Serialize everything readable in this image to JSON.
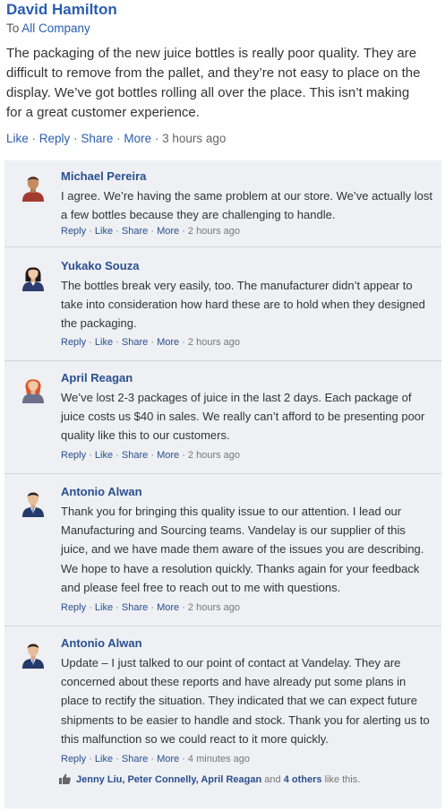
{
  "post": {
    "author": "David Hamilton",
    "to_prefix": "To",
    "to_group": "All Company",
    "body": "The packaging of the new juice bottles is really poor quality. They are difficult to remove from the pallet, and they’re not easy to place on the display. We’ve got bottles rolling all over the place. This isn’t making for a great customer experience.",
    "actions": {
      "like": "Like",
      "reply": "Reply",
      "share": "Share",
      "more": "More",
      "time": "3 hours ago"
    }
  },
  "comment_actions": {
    "reply": "Reply",
    "like": "Like",
    "share": "Share",
    "more": "More"
  },
  "comments": [
    {
      "name": "Michael Pereira",
      "body": "I agree. We’re having the same problem at our store. We’ve actually lost a few bottles because they are challenging to handle.",
      "time": "2 hours ago",
      "avatar": "man-avatar-icon"
    },
    {
      "name": "Yukako Souza",
      "body": "The bottles break very easily, too. The manufacturer didn’t appear to take into consideration how hard these are to hold when they designed the packaging.",
      "time": "2 hours ago",
      "avatar": "woman-avatar-icon"
    },
    {
      "name": "April Reagan",
      "body": "We’ve lost 2-3 packages of juice in the last 2 days. Each package of juice costs us $40 in sales. We really can’t afford to be presenting poor quality like this to our customers.",
      "time": "2 hours ago",
      "avatar": "woman-avatar-icon"
    },
    {
      "name": "Antonio Alwan",
      "body": "Thank you for bringing this quality issue to our attention. I lead our Manufacturing and Sourcing teams. Vandelay is our supplier of this juice, and we have made them aware of the issues you are describing. We hope to have a resolution quickly. Thanks again for your feedback and please feel free to reach out to me with questions.",
      "time": "2 hours ago",
      "avatar": "man-in-suit-avatar-icon"
    },
    {
      "name": "Antonio Alwan",
      "body": "Update – I just talked to our point of contact at Vandelay. They are concerned about these reports and have already put some plans in place to rectify the situation. They indicated that we can expect future shipments to be easier to handle and stock. Thank you for alerting us to this malfunction so we could react to it more quickly.",
      "time": "4 minutes ago",
      "avatar": "man-in-suit-avatar-icon"
    }
  ],
  "likes": {
    "icon": "thumbs-up-icon",
    "people": "Jenny Liu, Peter Connelly, April Reagan",
    "and": "and",
    "others": "4 others",
    "suffix": "like this."
  },
  "colors": {
    "name": "#2a4f8e",
    "link": "#2a5db0",
    "thread_bg": "#eef0f4",
    "divider": "#d4d8de"
  }
}
